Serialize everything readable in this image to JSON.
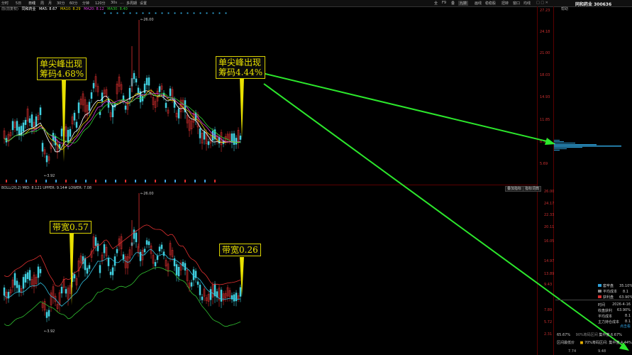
{
  "toolbar": {
    "items": [
      "分时",
      "5日",
      "日线",
      "周",
      "月",
      "30分",
      "60分",
      "分钟",
      "120分",
      "30s",
      "…",
      "多周期",
      "设置"
    ],
    "right_items": [
      "全",
      "F9",
      "叠",
      "九转",
      "画线",
      "稳稳股",
      "扭转",
      "窗口",
      "均线"
    ]
  },
  "chart_header": {
    "symbol_tab": "前(前复权)",
    "name": "同和药业",
    "ma5": "MA5: 8.67",
    "ma10": "MA10: 8.29",
    "ma20": "MA20: 8.12",
    "ma30": "MA30: 8.40"
  },
  "price_axis": [
    "27.23",
    "24.18",
    "21.00",
    "18.03",
    "14.93",
    "11.85",
    "8.97",
    "5.69"
  ],
  "price_annotations": {
    "high": "26.00",
    "low": "3.92"
  },
  "annotation_left_top": {
    "line1": "单尖峰出现",
    "line2": "筹码4.68%"
  },
  "annotation_right_top": {
    "line1": "单尖峰出现",
    "line2": "筹码4.44%"
  },
  "boll_header": "BOLL(20,2) MID: 8.121  UPPER: 9.14#  LOWER: 7.08",
  "boll_buttons": [
    "叠加指标",
    "指标词典"
  ],
  "boll_axis": [
    "26.00",
    "24.17",
    "22.33",
    "20.11",
    "16.05",
    "14.97",
    "13.89",
    "9.43",
    "7.89",
    "5.72",
    "2.31"
  ],
  "boll_annotations": {
    "high": "26.00",
    "low": "3.92"
  },
  "annotation_left_bottom": "带宽0.57",
  "annotation_right_bottom": "带宽0.26",
  "right_panel": {
    "title": "同和药业 300636",
    "help": "帮助",
    "legend": [
      {
        "label": "套牢盘",
        "value": "35.10%",
        "color": "#2ea0d8"
      },
      {
        "label": "平均成本",
        "value": "8.1",
        "color": "#888888"
      },
      {
        "label": "获利盘",
        "value": "63.90%",
        "color": "#d83030"
      }
    ],
    "stats": [
      {
        "label": "时间",
        "value": "2026-4-16"
      },
      {
        "label": "收盘获利",
        "value": "63.90%"
      },
      {
        "label": "平均成本",
        "value": "8.1"
      },
      {
        "label": "主力持仓成本",
        "value": "8.1"
      }
    ],
    "stock_rank_label": "点击看",
    "concentration": [
      {
        "pct": "65.67%",
        "label": "90%筹码区间",
        "suffix": "集中度",
        "value": "6.67%"
      },
      {
        "label": "区间最低价",
        "pct": "",
        "suffix": "70%筹码区间: 集中度",
        "value": "4.44%"
      }
    ],
    "bottom_nums": [
      "7.74",
      "9.48"
    ]
  }
}
